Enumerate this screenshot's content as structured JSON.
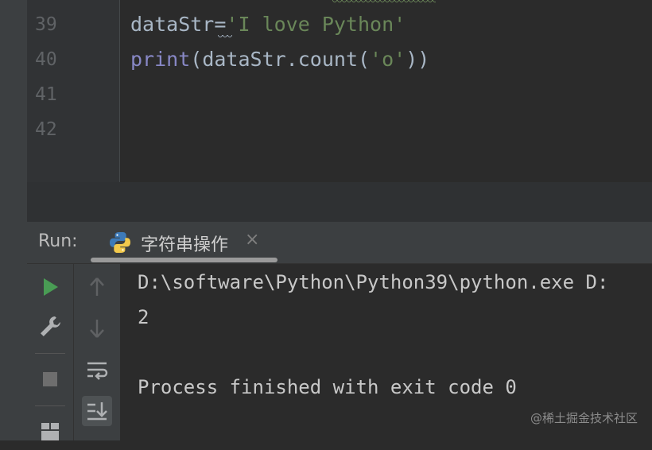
{
  "editor": {
    "line_numbers": [
      "39",
      "40",
      "41",
      "42"
    ],
    "lines": [
      {
        "var": "dataStr",
        "op": "=",
        "str": "'I love Python'"
      },
      {
        "func": "print",
        "open": "(",
        "expr": "dataStr.count(",
        "arg": "'o'",
        "close": "))"
      }
    ]
  },
  "run_panel": {
    "label": "Run:",
    "tab": {
      "title": "字符串操作",
      "close": "×",
      "icon": "python-icon"
    },
    "toolbar1_icons": [
      "run-icon",
      "wrench-icon",
      "stop-icon",
      "layout-icon"
    ],
    "toolbar2_icons": [
      "up-arrow-icon",
      "down-arrow-icon",
      "soft-wrap-icon",
      "scroll-to-end-icon"
    ]
  },
  "console": {
    "lines": [
      "D:\\software\\Python\\Python39\\python.exe D:",
      "2",
      "",
      "Process finished with exit code 0"
    ]
  },
  "watermark": "@稀土掘金技术社区",
  "colors": {
    "editor_bg": "#2b2b2b",
    "string": "#6a8759",
    "builtin": "#8888c6",
    "run_green": "#499c54"
  }
}
